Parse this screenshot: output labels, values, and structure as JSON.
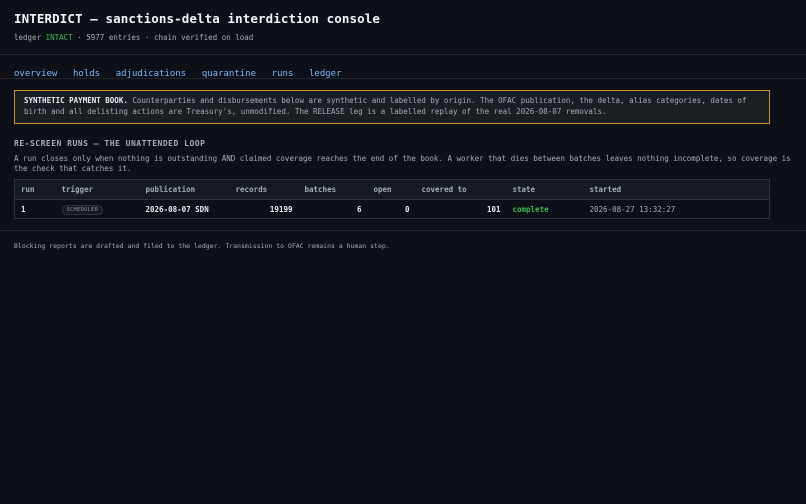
{
  "app": {
    "title": "INTERDICT — sanctions-delta interdiction console",
    "ledger_label": "ledger",
    "ledger_state": "INTACT",
    "ledger_detail": "· 5977 entries · chain verified on load"
  },
  "nav": {
    "items": [
      "overview",
      "holds",
      "adjudications",
      "quarantine",
      "runs",
      "ledger"
    ]
  },
  "banner": {
    "strong": "SYNTHETIC PAYMENT BOOK.",
    "text": " Counterparties and disbursements below are synthetic and labelled by origin. The OFAC publication, the delta, alias categories, dates of birth and all delisting actions are Treasury's, unmodified. The RELEASE leg is a labelled replay of the real 2026-08-07 removals."
  },
  "section": {
    "title": "RE-SCREEN RUNS — THE UNATTENDED LOOP",
    "description": "A run closes only when nothing is outstanding AND claimed coverage reaches the end of the book. A worker that dies between batches leaves nothing incomplete, so coverage is the check that catches it."
  },
  "table": {
    "columns": [
      "run",
      "trigger",
      "publication",
      "records",
      "batches",
      "open",
      "covered to",
      "state",
      "started"
    ],
    "rows": [
      {
        "run": "1",
        "trigger": "SCHEDULER",
        "publication": "2026-08-07 SDN",
        "records": "19199",
        "batches": "6",
        "open": "0",
        "covered_to": "101",
        "state": "complete",
        "started": "2026-08-27 13:32:27"
      }
    ]
  },
  "footer": {
    "text": "Blocking reports are drafted and filed to the ledger. Transmission to OFAC remains a human step."
  },
  "colors": {
    "background": "#0d1117",
    "link": "#79b8ff",
    "ok": "#3fb950",
    "warning_border": "#c9922a"
  }
}
